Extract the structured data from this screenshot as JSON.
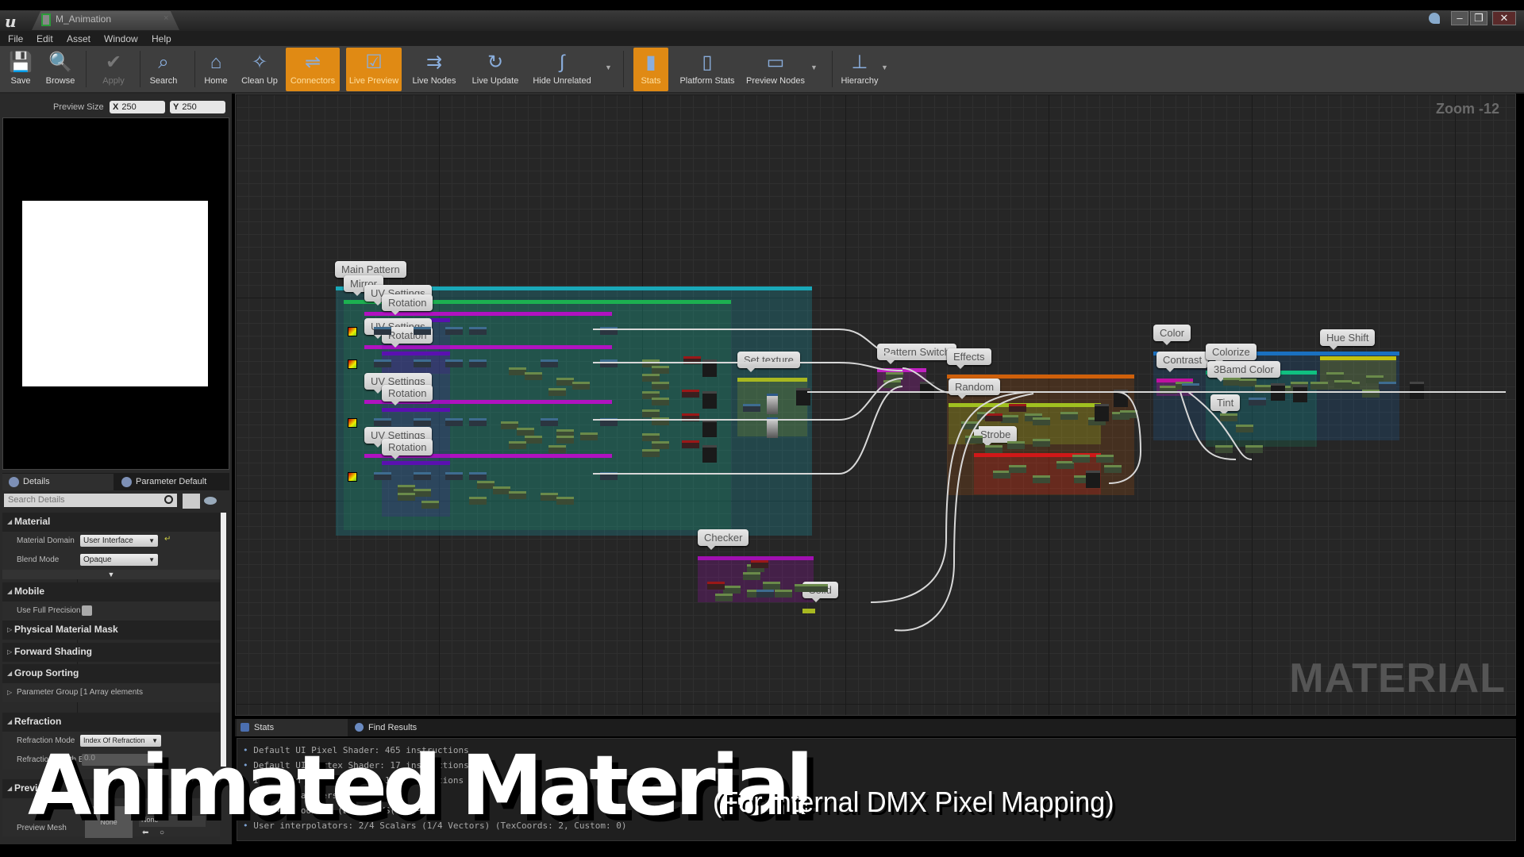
{
  "window": {
    "app_logo": "u",
    "tab_title": "M_Animation",
    "tab_close": "×",
    "controls": {
      "minimize": "–",
      "restore": "❐",
      "close": "✕"
    }
  },
  "menu": [
    "File",
    "Edit",
    "Asset",
    "Window",
    "Help"
  ],
  "toolbar": [
    {
      "label": "Save",
      "icon": "save-icon",
      "glyph": "💾",
      "state": "normal"
    },
    {
      "label": "Browse",
      "icon": "browse-icon",
      "glyph": "🔍",
      "state": "normal"
    },
    {
      "label": "Apply",
      "icon": "apply-icon",
      "glyph": "✔",
      "state": "disabled"
    },
    {
      "label": "Search",
      "icon": "binoculars-icon",
      "glyph": "⌕",
      "state": "normal"
    },
    {
      "label": "Home",
      "icon": "home-icon",
      "glyph": "⌂",
      "state": "normal"
    },
    {
      "label": "Clean Up",
      "icon": "broom-icon",
      "glyph": "✧",
      "state": "normal"
    },
    {
      "label": "Connectors",
      "icon": "connectors-icon",
      "glyph": "⇌",
      "state": "active"
    },
    {
      "label": "Live Preview",
      "icon": "live-preview-icon",
      "glyph": "☑",
      "state": "active"
    },
    {
      "label": "Live Nodes",
      "icon": "live-nodes-icon",
      "glyph": "⇉",
      "state": "normal"
    },
    {
      "label": "Live Update",
      "icon": "live-update-icon",
      "glyph": "↻",
      "state": "normal"
    },
    {
      "label": "Hide Unrelated",
      "icon": "hide-unrelated-icon",
      "glyph": "∫",
      "state": "normal"
    },
    {
      "label": "Stats",
      "icon": "stats-icon",
      "glyph": "▮",
      "state": "active"
    },
    {
      "label": "Platform Stats",
      "icon": "platform-stats-icon",
      "glyph": "▯",
      "state": "normal"
    },
    {
      "label": "Preview Nodes",
      "icon": "preview-nodes-icon",
      "glyph": "▭",
      "state": "normal"
    },
    {
      "label": "Hierarchy",
      "icon": "hierarchy-icon",
      "glyph": "⊥",
      "state": "normal"
    }
  ],
  "preview": {
    "size_label": "Preview Size",
    "x_axis": "X",
    "x_value": "250",
    "y_axis": "Y",
    "y_value": "250"
  },
  "details": {
    "tabs": [
      "Details",
      "Parameter Default"
    ],
    "search_placeholder": "Search Details",
    "sections": {
      "material": "Material",
      "material_domain_label": "Material Domain",
      "material_domain_value": "User Interface",
      "blend_mode_label": "Blend Mode",
      "blend_mode_value": "Opaque",
      "mobile": "Mobile",
      "use_full_precision_label": "Use Full Precision",
      "physical_material_mask": "Physical Material Mask",
      "forward_shading": "Forward Shading",
      "group_sorting": "Group Sorting",
      "parameter_group_label": "Parameter Group [",
      "parameter_group_value": "1 Array elements",
      "refraction": "Refraction",
      "refraction_mode_label": "Refraction Mode",
      "refraction_mode_value": "Index Of Refraction",
      "refraction_depth_label": "Refraction Depth B",
      "refraction_depth_value": "0.0",
      "preview": "Previous",
      "preview_mesh_label": "Preview Mesh",
      "preview_mesh_value": "None",
      "preview_mesh_combo": "None"
    }
  },
  "graph": {
    "zoom": "Zoom -12",
    "watermark": "MATERIAL",
    "comments": {
      "main_pattern": "Main Pattern",
      "mirror": "Mirror",
      "uv1": "UV Settings",
      "rot1": "Rotation",
      "uv2": "UV Settings",
      "rot2": "Rotation",
      "uv3": "UV Settings",
      "rot3": "Rotation",
      "uv4": "UV Settings",
      "rot4": "Rotation",
      "set_texture": "Set texture",
      "pattern_switch": "Pattern Switch",
      "effects": "Effects",
      "random": "Random",
      "strobe": "Strobe",
      "checker": "Checker",
      "solid": "Solid",
      "color": "Color",
      "contrast": "Contrast",
      "colorize": "Colorize",
      "three_band_color": "3Bamd Color",
      "tint": "Tint",
      "hue_shift": "Hue Shift"
    }
  },
  "bottom": {
    "tabs": [
      "Stats",
      "Find Results"
    ],
    "stats": [
      "Default UI Pixel Shader: 465 instructions",
      "Default UI Vertex Shader: 17 instructions",
      "Instanced Vertex Shader: 17 instructions",
      "Texture samplers: 16",
      "Texture Lookups (Est.): VS(0), PS(…)",
      "User interpolators: 2/4 Scalars (1/4 Vectors) (TexCoords: 2, Custom: 0)"
    ]
  },
  "overlay": {
    "title": "Animated Material",
    "subtitle": "(For internal DMX Pixel Mapping)"
  },
  "colors": {
    "active_button": "#e08a14",
    "main_pattern": "#1aa8b8",
    "mirror": "#1cb050",
    "uv_settings": "#b012c0",
    "rotation": "#5a10b0",
    "set_texture": "#a8b820",
    "pattern_switch": "#c020c0",
    "effects": "#d0600a",
    "random": "#a0c020",
    "strobe": "#d01818",
    "checker": "#a010b0",
    "color": "#1a70c0",
    "contrast": "#c010a0",
    "colorize": "#10c080",
    "hue_shift": "#c0c010"
  }
}
